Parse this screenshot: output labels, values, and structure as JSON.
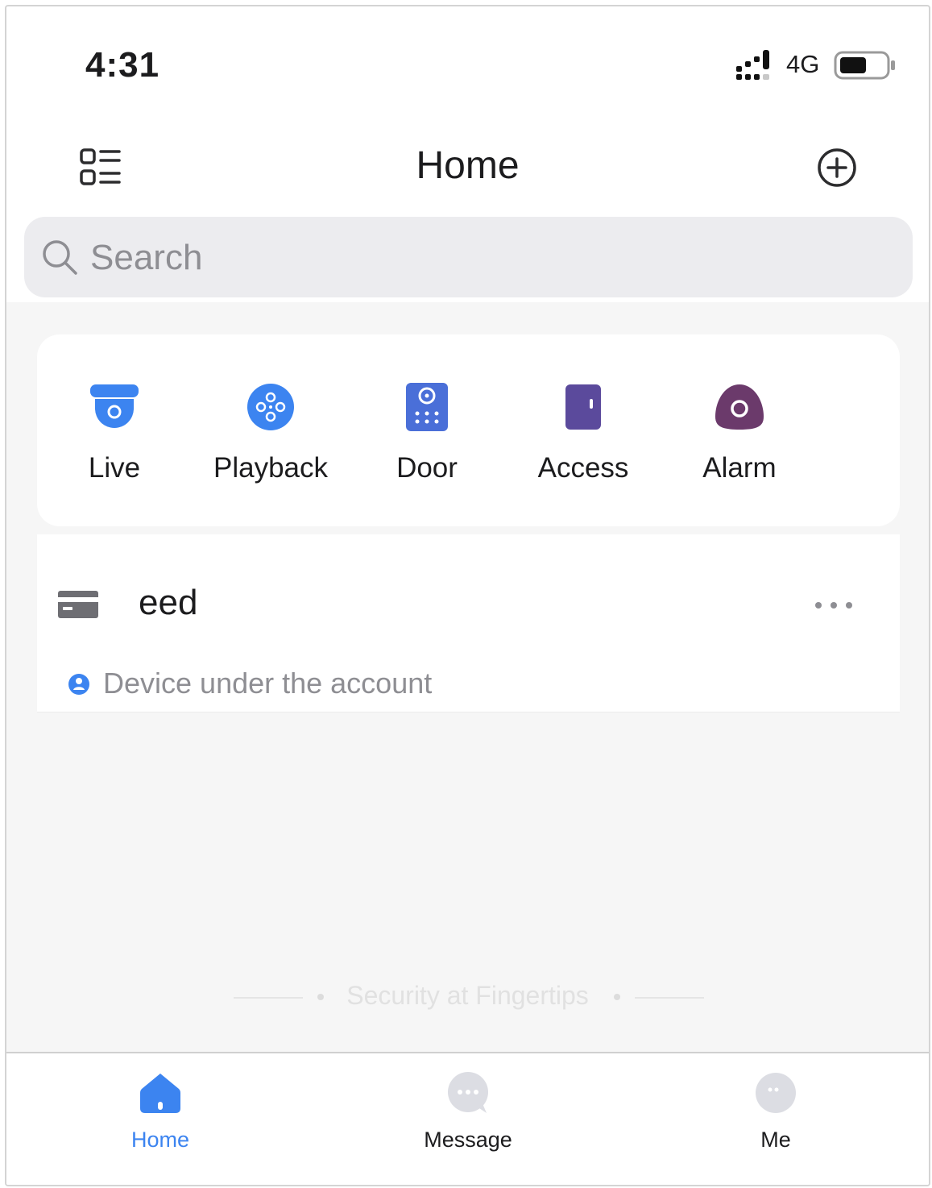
{
  "status_bar": {
    "time": "4:31",
    "network": "4G"
  },
  "header": {
    "title": "Home"
  },
  "search": {
    "placeholder": "Search"
  },
  "quick_actions": [
    {
      "label": "Live",
      "icon": "camera-icon",
      "color": "#3c84f0"
    },
    {
      "label": "Playback",
      "icon": "playback-icon",
      "color": "#3c84f0"
    },
    {
      "label": "Door",
      "icon": "door-intercom-icon",
      "color": "#4a6fd8"
    },
    {
      "label": "Access",
      "icon": "access-control-icon",
      "color": "#5b4a9c"
    },
    {
      "label": "Alarm",
      "icon": "alarm-icon",
      "color": "#6b3a6b"
    }
  ],
  "device": {
    "name": "eed",
    "icon": "recorder-icon",
    "group_label": "Device under the account"
  },
  "slogan": "Security at Fingertips",
  "tabs": [
    {
      "label": "Home",
      "icon": "home-icon",
      "active": true
    },
    {
      "label": "Message",
      "icon": "message-icon",
      "active": false
    },
    {
      "label": "Me",
      "icon": "profile-icon",
      "active": false
    }
  ],
  "colors": {
    "accent": "#3c84f0",
    "background": "#f6f6f6",
    "search_bg": "#ececef"
  }
}
